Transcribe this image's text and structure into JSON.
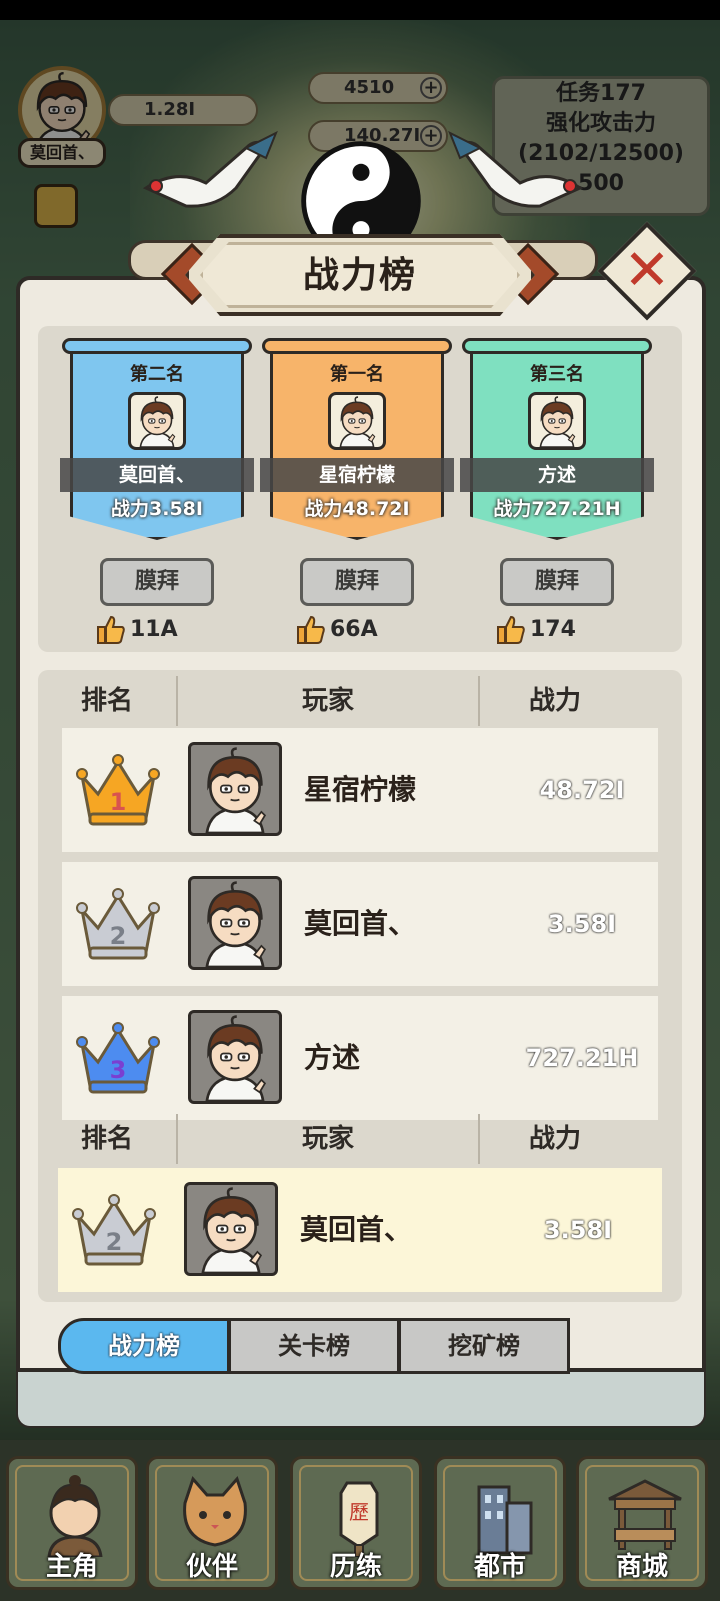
{
  "hud": {
    "player_name": "莫回首、",
    "power": "1.28I",
    "gems": "4510",
    "coins": "140.27I",
    "mission_title": "任务177",
    "mission_desc": "强化攻击力",
    "mission_progress": "(2102/12500)",
    "mission_reward": "500"
  },
  "title": "战力榜",
  "podium": [
    {
      "rank_label": "第二名",
      "name": "莫回首、",
      "power": "战力3.58I",
      "worship_label": "膜拜",
      "likes": "11A",
      "color": "#7fc6ef"
    },
    {
      "rank_label": "第一名",
      "name": "星宿柠檬",
      "power": "战力48.72I",
      "worship_label": "膜拜",
      "likes": "66A",
      "color": "#f7b46a"
    },
    {
      "rank_label": "第三名",
      "name": "方述",
      "power": "战力727.21H",
      "worship_label": "膜拜",
      "likes": "174",
      "color": "#7fe0c0"
    }
  ],
  "table": {
    "headers": {
      "rank": "排名",
      "player": "玩家",
      "power": "战力"
    },
    "rows": [
      {
        "rank": 1,
        "name": "星宿柠檬",
        "power": "48.72I"
      },
      {
        "rank": 2,
        "name": "莫回首、",
        "power": "3.58I"
      },
      {
        "rank": 3,
        "name": "方述",
        "power": "727.21H"
      }
    ],
    "me": {
      "rank": 2,
      "name": "莫回首、",
      "power": "3.58I"
    }
  },
  "tabs": [
    {
      "label": "战力榜",
      "active": true
    },
    {
      "label": "关卡榜",
      "active": false
    },
    {
      "label": "挖矿榜",
      "active": false
    }
  ],
  "nav": [
    {
      "label": "主角",
      "icon": "protagonist-icon"
    },
    {
      "label": "伙伴",
      "icon": "cat-partner-icon"
    },
    {
      "label": "历练",
      "icon": "training-sign-icon"
    },
    {
      "label": "都市",
      "icon": "city-buildings-icon"
    },
    {
      "label": "商城",
      "icon": "shop-stall-icon"
    }
  ],
  "colors": {
    "gold_crown": "#f6a623",
    "silver_crown": "#c9ccd3",
    "blue_crown": "#4d8cf0",
    "active_tab": "#5bb8ef",
    "close_x": "#c0392b"
  }
}
